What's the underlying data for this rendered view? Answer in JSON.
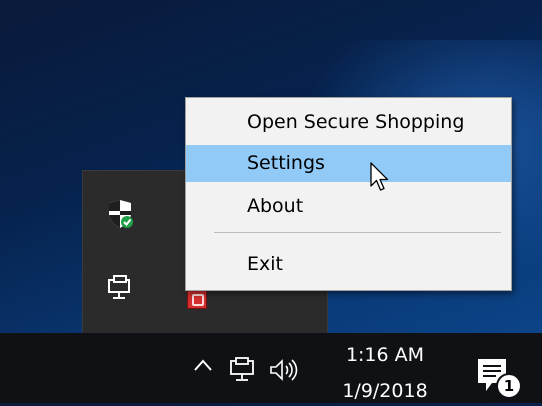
{
  "context_menu": {
    "items": [
      {
        "label": "Open Secure Shopping"
      },
      {
        "label": "Settings",
        "state": "hovered"
      },
      {
        "label": "About"
      },
      {
        "label": "Exit"
      }
    ]
  },
  "tray_overflow": {
    "icons": [
      "shield-check-icon",
      "network-monitor-icon",
      "red-app-icon"
    ]
  },
  "taskbar": {
    "icons": [
      "chevron-up-icon",
      "network-icon",
      "volume-icon",
      "action-center-icon"
    ],
    "clock": {
      "time": "1:16 AM",
      "date": "1/9/2018"
    },
    "notification_count": "1"
  },
  "colors": {
    "menu_background": "#f2f2f2",
    "menu_highlight": "#91c9f7",
    "taskbar": "#0f1115",
    "tray_flyout": "#2b2b2b"
  }
}
